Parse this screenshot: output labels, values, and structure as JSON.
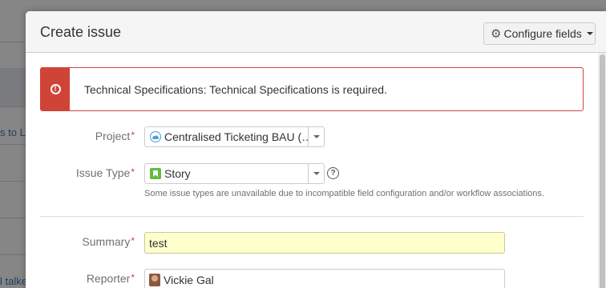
{
  "background": {
    "snippets": [
      "s to Li",
      "l talke"
    ]
  },
  "dialog": {
    "title": "Create issue",
    "configure_fields_label": "Configure fields",
    "error_message": "Technical Specifications: Technical Specifications is required."
  },
  "form": {
    "project": {
      "label": "Project",
      "required_mark": "*",
      "value": "Centralised Ticketing BAU (…"
    },
    "issue_type": {
      "label": "Issue Type",
      "required_mark": "*",
      "value": "Story",
      "help_glyph": "?",
      "description": "Some issue types are unavailable due to incompatible field configuration and/or workflow associations."
    },
    "summary": {
      "label": "Summary",
      "required_mark": "*",
      "value": "test"
    },
    "reporter": {
      "label": "Reporter",
      "required_mark": "*",
      "value": "Vickie Gal"
    }
  },
  "icons": {
    "config": "gear-icon",
    "error": "exclamation-circle-icon",
    "project": "project-avatar-icon",
    "issue_type": "story-icon",
    "help": "help-icon"
  },
  "colors": {
    "error": "#d04437",
    "summary_bg": "#ffffcc",
    "link": "#3b73af",
    "story": "#63ba3c"
  }
}
